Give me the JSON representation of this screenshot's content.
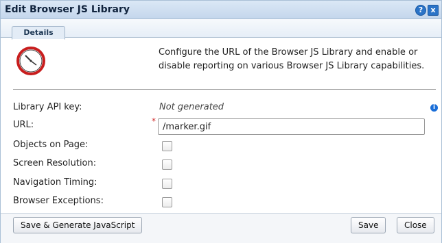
{
  "window": {
    "title": "Edit Browser JS Library",
    "help_symbol": "?",
    "close_symbol": "x"
  },
  "tabs": [
    {
      "label": "Details",
      "active": true
    }
  ],
  "description": "Configure the URL of the Browser JS Library and enable or disable reporting on various Browser JS Library capabilities.",
  "form": {
    "api_key": {
      "label": "Library API key:",
      "value": "Not generated"
    },
    "url": {
      "label": "URL:",
      "required_marker": "*",
      "value": "/marker.gif"
    },
    "checkboxes": [
      {
        "label": "Objects on Page:",
        "checked": false
      },
      {
        "label": "Screen Resolution:",
        "checked": false
      },
      {
        "label": "Navigation Timing:",
        "checked": false
      },
      {
        "label": "Browser Exceptions:",
        "checked": false
      }
    ]
  },
  "buttons": {
    "save_generate": "Save & Generate JavaScript",
    "save": "Save",
    "close": "Close"
  },
  "icons": {
    "info": "i"
  },
  "colors": {
    "titlebar": "#c4d6ec",
    "accent": "#2a73c7",
    "clock_red": "#c81e1e",
    "required": "#d02b2b"
  }
}
